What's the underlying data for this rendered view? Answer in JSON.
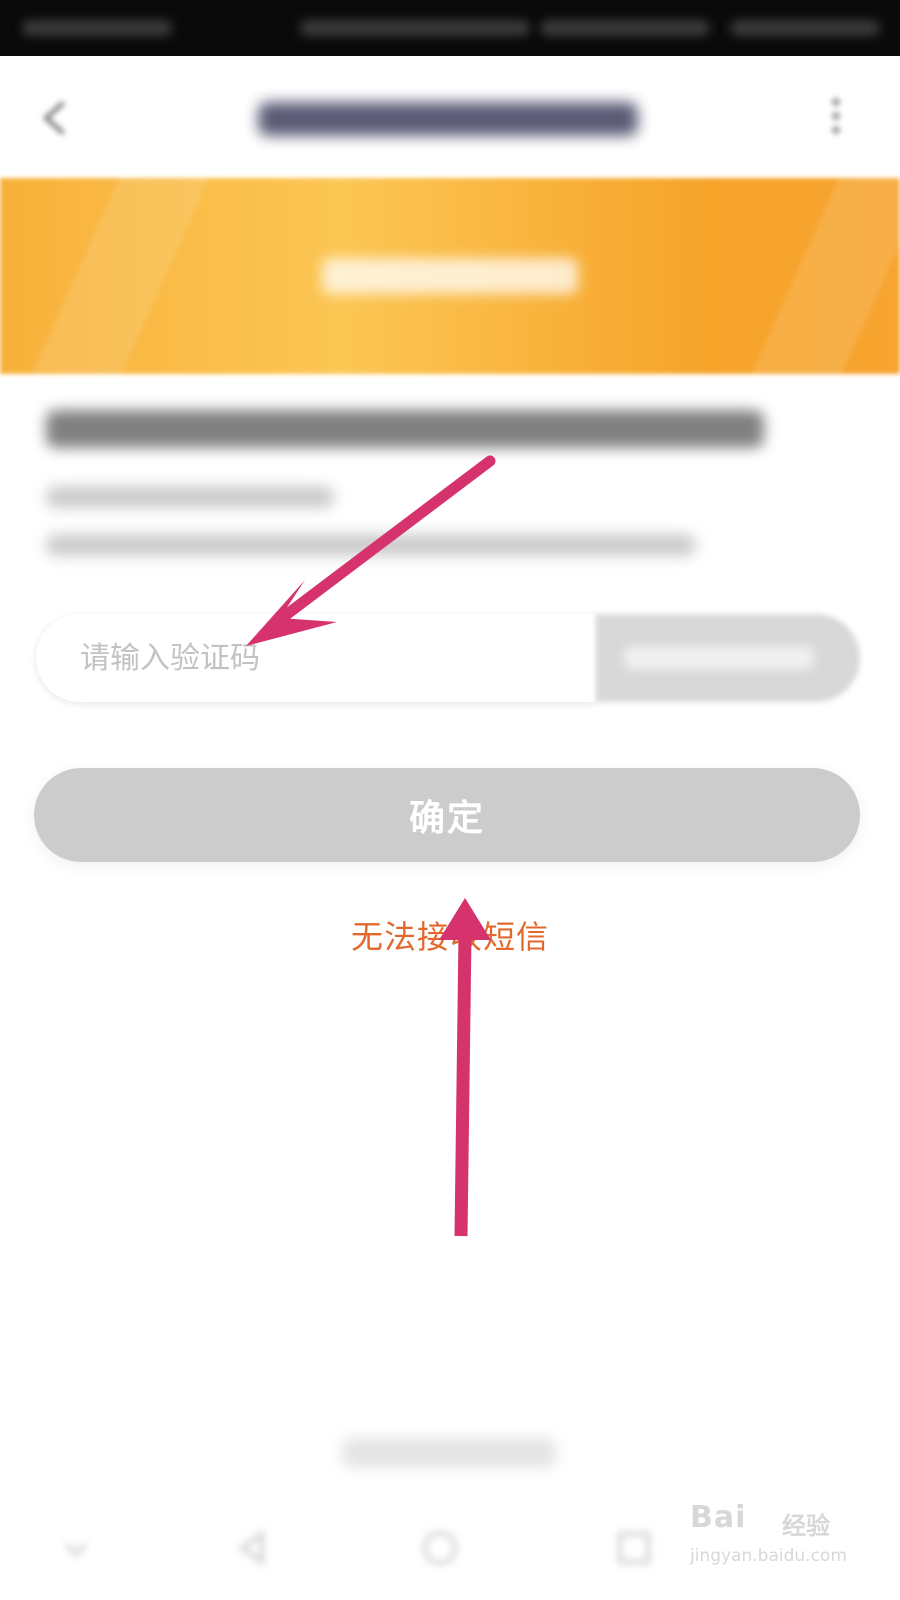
{
  "verify_form": {
    "code_placeholder": "请输入验证码",
    "confirm_label": "确定",
    "cannot_receive_sms": "无法接收短信"
  },
  "watermark": {
    "logo_text": "Bai",
    "logo_tag": "经验",
    "url": "jingyan.baidu.com"
  },
  "colors": {
    "banner_accent": "#f8b13a",
    "link_text": "#e2692d",
    "confirm_disabled": "#cccccc",
    "annotation_arrow": "#d6336e"
  },
  "icons": {
    "back": "chevron-left-icon",
    "more": "more-vertical-icon",
    "annotation": "arrow-icon"
  }
}
